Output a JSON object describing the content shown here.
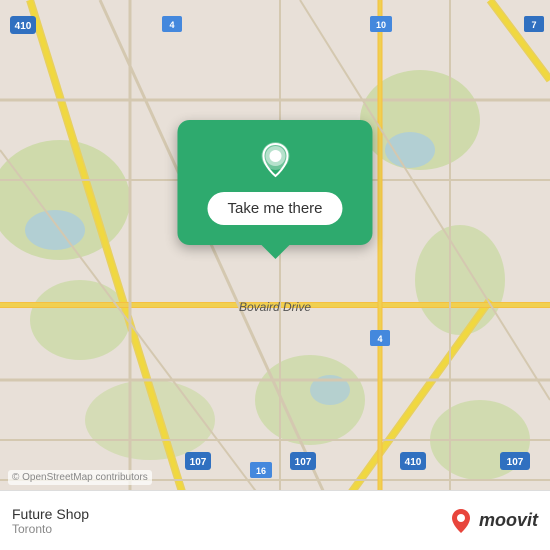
{
  "map": {
    "copyright": "© OpenStreetMap contributors",
    "road_label": "Bovaird Drive",
    "background_color": "#e8e0d8"
  },
  "popup": {
    "button_label": "Take me there",
    "pin_icon": "location-pin-icon"
  },
  "bottom_bar": {
    "location_name": "Future Shop",
    "location_city": "Toronto",
    "moovit_logo_text": "moovit"
  }
}
